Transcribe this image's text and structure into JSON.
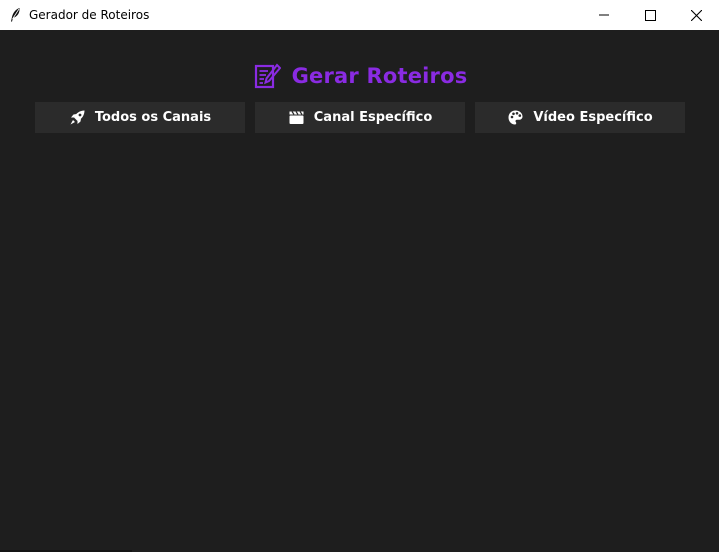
{
  "window": {
    "title": "Gerador de Roteiros",
    "app_icon": "feather-icon",
    "controls": {
      "minimize_icon": "minimize-icon",
      "maximize_icon": "maximize-icon",
      "close_icon": "close-icon"
    }
  },
  "header": {
    "icon": "memo-icon",
    "title": "Gerar Roteiros",
    "accent_color": "#8a2be2"
  },
  "actions": [
    {
      "label": "Todos os Canais",
      "icon": "rocket-icon"
    },
    {
      "label": "Canal Específico",
      "icon": "clapperboard-icon"
    },
    {
      "label": "Vídeo Específico",
      "icon": "palette-icon"
    }
  ],
  "colors": {
    "background": "#1e1e1e",
    "button_bg": "#2b2b2b",
    "titlebar_bg": "#ffffff",
    "text": "#ffffff"
  }
}
